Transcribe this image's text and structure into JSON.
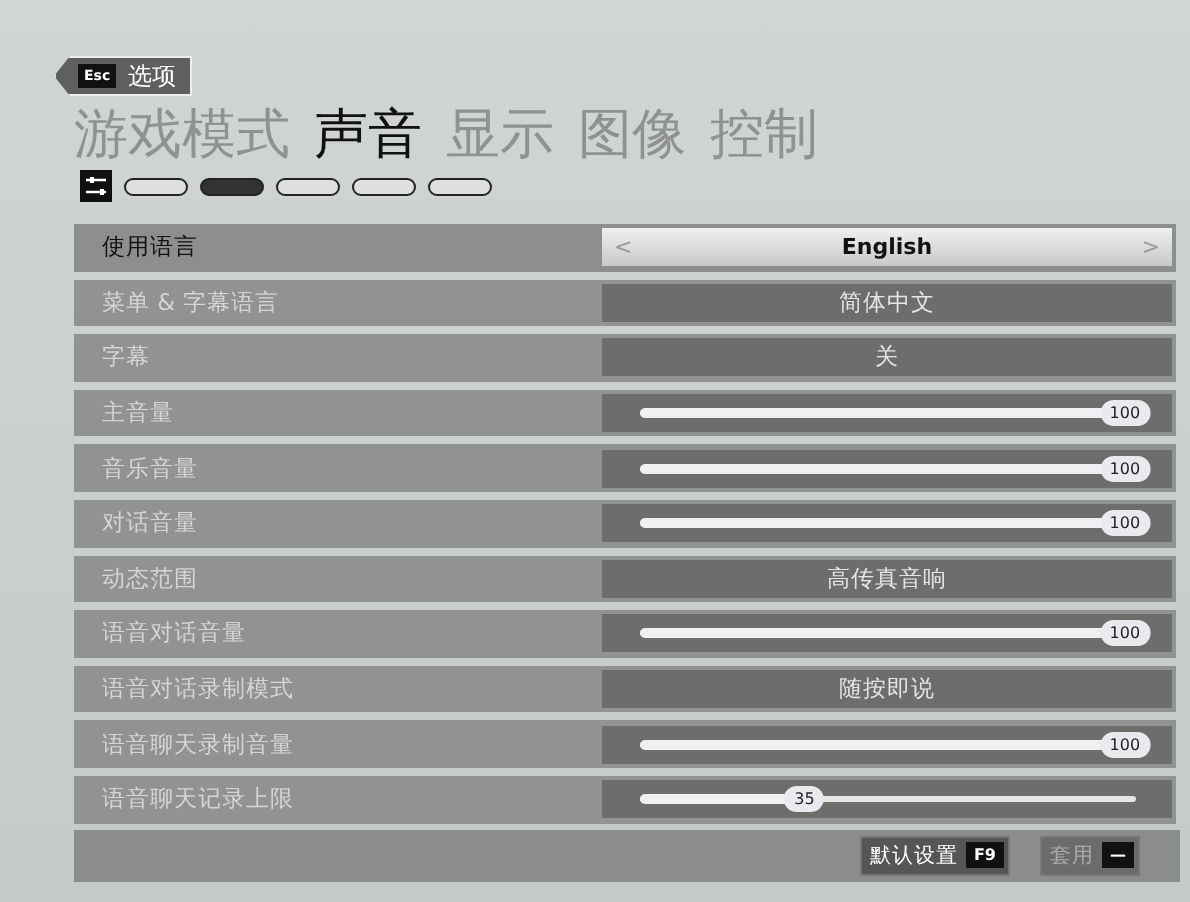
{
  "back_button": {
    "key": "Esc",
    "label": "选项"
  },
  "tabs": [
    {
      "label": "游戏模式",
      "selected": false
    },
    {
      "label": "声音",
      "selected": true
    },
    {
      "label": "显示",
      "selected": false
    },
    {
      "label": "图像",
      "selected": false
    },
    {
      "label": "控制",
      "selected": false
    }
  ],
  "subtabs": [
    {
      "kind": "icon",
      "selected": false
    },
    {
      "kind": "pill",
      "selected": false
    },
    {
      "kind": "pill",
      "selected": true
    },
    {
      "kind": "pill",
      "selected": false
    },
    {
      "kind": "pill",
      "selected": false
    },
    {
      "kind": "pill",
      "selected": false
    }
  ],
  "settings": [
    {
      "kind": "choice",
      "label": "使用语言",
      "value": "English",
      "selected": true,
      "prev": "<",
      "next": ">"
    },
    {
      "kind": "choice",
      "label": "菜单 & 字幕语言",
      "value": "简体中文",
      "selected": false
    },
    {
      "kind": "choice",
      "label": "字幕",
      "value": "关",
      "selected": false
    },
    {
      "kind": "slider",
      "label": "主音量",
      "level": 1,
      "reading": "100",
      "selected": false
    },
    {
      "kind": "slider",
      "label": "音乐音量",
      "level": 1,
      "reading": "100",
      "selected": false
    },
    {
      "kind": "slider",
      "label": "对话音量",
      "level": 1,
      "reading": "100",
      "selected": false
    },
    {
      "kind": "choice",
      "label": "动态范围",
      "value": "高传真音响",
      "selected": false
    },
    {
      "kind": "slider",
      "label": "语音对话音量",
      "level": 1,
      "reading": "100",
      "selected": false
    },
    {
      "kind": "choice",
      "label": "语音对话录制模式",
      "value": "随按即说",
      "selected": false
    },
    {
      "kind": "slider",
      "label": "语音聊天录制音量",
      "level": 1,
      "reading": "100",
      "selected": false
    },
    {
      "kind": "slider",
      "label": "语音聊天记录上限",
      "level": 0.35,
      "reading": "35",
      "selected": false
    }
  ],
  "footer": {
    "buttons": [
      {
        "label": "默认设置",
        "key": "F9",
        "disabled": false
      },
      {
        "label": "套用",
        "key": "—",
        "disabled": true
      }
    ]
  }
}
